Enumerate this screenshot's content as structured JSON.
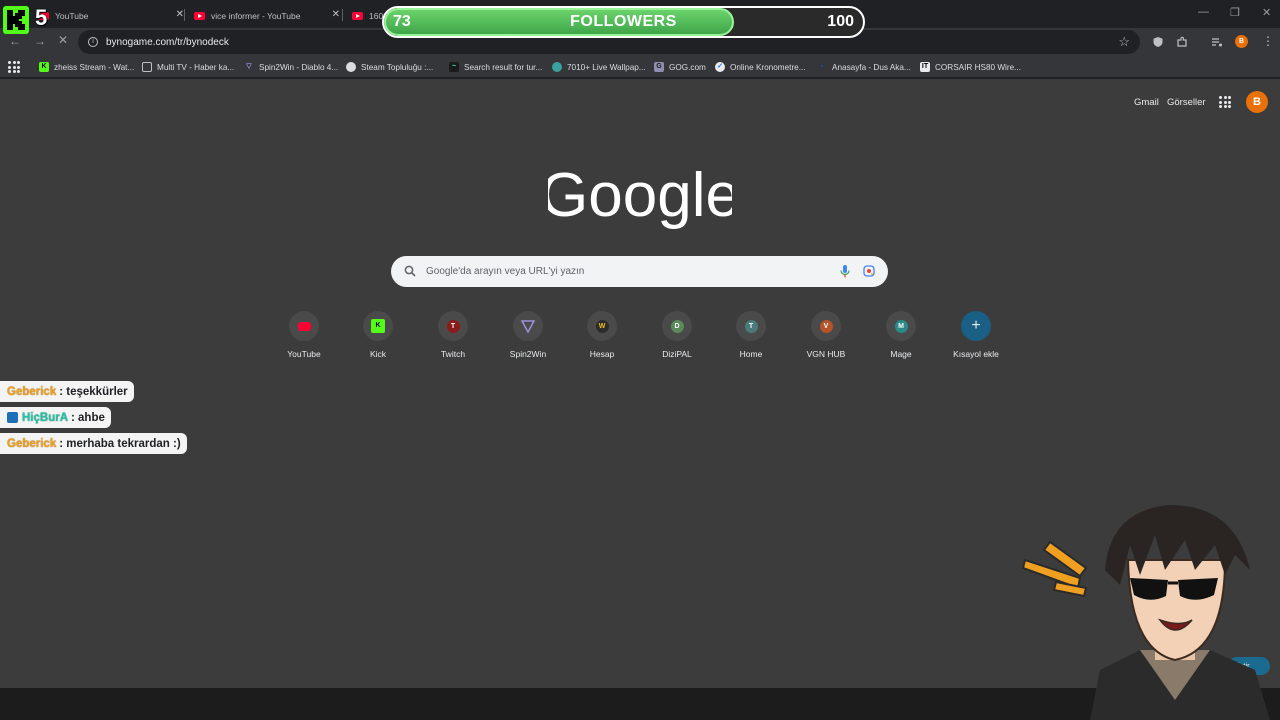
{
  "browser": {
    "tabs": [
      {
        "title": "YouTube"
      },
      {
        "title": "vice informer - YouTube"
      },
      {
        "title": "1600"
      }
    ],
    "url": "bynogame.com/tr/bynodeck",
    "profile_initial": "B",
    "bookmarks": [
      {
        "label": "zheiss Stream - Wat...",
        "icon": "kick-icon"
      },
      {
        "label": "Multi TV - Haber ka...",
        "icon": "tv-icon"
      },
      {
        "label": "Spin2Win - Diablo 4...",
        "icon": "shield-icon"
      },
      {
        "label": "Steam Topluluğu :...",
        "icon": "steam-icon"
      },
      {
        "label": "Search result for tur...",
        "icon": "search-icon"
      },
      {
        "label": "7010+ Live Wallpap...",
        "icon": "globe-icon"
      },
      {
        "label": "GOG.com",
        "icon": "gog-icon"
      },
      {
        "label": "Online Kronometre...",
        "icon": "check-icon"
      },
      {
        "label": "Anasayfa - Dus Aka...",
        "icon": "dus-icon"
      },
      {
        "label": "CORSAIR HS80 Wire...",
        "icon": "corsair-icon"
      }
    ]
  },
  "google": {
    "top_links": {
      "gmail": "Gmail",
      "images": "Görseller"
    },
    "avatar_initial": "B",
    "logo_text": "Google",
    "search_placeholder": "Google'da arayın veya URL'yi yazın",
    "shortcuts": [
      {
        "label": "YouTube",
        "icon_text": "",
        "color": "#ff0033"
      },
      {
        "label": "Kick",
        "icon_text": "K",
        "color": "#53fc18"
      },
      {
        "label": "Twitch",
        "icon_text": "T",
        "color": "#8b1a1a"
      },
      {
        "label": "Spin2Win",
        "icon_text": "",
        "color": "#6a5acd"
      },
      {
        "label": "Hesap",
        "icon_text": "W",
        "color": "#2b2b2b"
      },
      {
        "label": "DiziPAL",
        "icon_text": "D",
        "color": "#5a8a5a"
      },
      {
        "label": "Home",
        "icon_text": "T",
        "color": "#4a7a7a"
      },
      {
        "label": "VGN HUB",
        "icon_text": "V",
        "color": "#b5542a"
      },
      {
        "label": "Mage",
        "icon_text": "M",
        "color": "#2a8a8a"
      },
      {
        "label": "Kısayol ekle",
        "icon_text": "+",
        "color": "#1a5f86"
      }
    ],
    "customize_partial": "iştir"
  },
  "overlay": {
    "kick_count": "5",
    "followers": {
      "current": "73",
      "label": "FOLLOWERS",
      "goal": "100",
      "progress": 0.73
    },
    "chat": [
      {
        "user": "Geberick",
        "message": ": teşekkürler",
        "style": "orange"
      },
      {
        "user": "HiçBurA",
        "message": ": ahbe",
        "style": "teal"
      },
      {
        "user": "Geberick",
        "message": ": merhaba tekrardan :)",
        "style": "orange"
      }
    ]
  }
}
